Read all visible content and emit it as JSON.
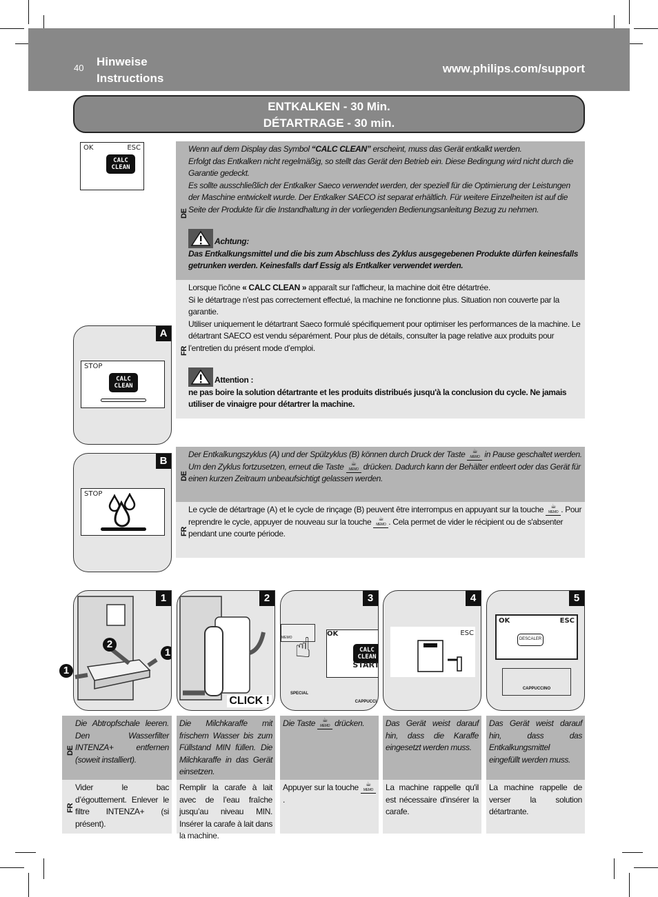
{
  "header": {
    "page_number": "40",
    "title_line1": "Hinweise",
    "title_line2": "Instructions",
    "url": "www.philips.com/support"
  },
  "section_title": {
    "line1": "ENTKALKEN - 30 Min.",
    "line2": "DÉTARTRAGE - 30 min."
  },
  "colors": {
    "header_bg": "#888888",
    "de_bg": "#b4b4b4",
    "fr_bg": "#e6e6e6",
    "badge_bg": "#111111"
  },
  "display_main": {
    "ok": "OK",
    "esc": "ESC",
    "icon_line1": "CALC",
    "icon_line2": "CLEAN"
  },
  "display_a": {
    "badge": "A",
    "stop": "STOP",
    "icon_line1": "CALC",
    "icon_line2": "CLEAN"
  },
  "display_b": {
    "badge": "B",
    "stop": "STOP",
    "icon": "water-drops-icon"
  },
  "intro": {
    "de": {
      "lang": "DE",
      "l1_pre": "Wenn auf dem Display das Symbol ",
      "l1_bold": "“CALC CLEAN”",
      "l1_post": " erscheint, muss das Gerät entkalkt werden.",
      "l2": "Erfolgt das Entkalken nicht regelmäßig, so stellt das Gerät den Betrieb ein. Diese Bedingung wird nicht durch die Garantie gedeckt.",
      "l3": "Es sollte ausschließlich der Entkalker Saeco verwendet werden, der speziell für die Optimierung der Leistungen der Maschine entwickelt wurde. Der Entkalker SAECO ist separat erhältlich. Für weitere Einzelheiten ist auf die Seite der Produkte für die Instandhaltung in der vorliegenden Bedienungsanleitung Bezug zu nehmen.",
      "warning_label": "Achtung:",
      "warning_text": "Das Entkalkungsmittel und die bis zum Abschluss des Zyklus ausgegebenen Produkte dürfen keinesfalls getrunken werden. Keinesfalls darf Essig als Entkalker verwendet werden."
    },
    "fr": {
      "lang": "FR",
      "l1_pre": "Lorsque l'icône ",
      "l1_bold": "« CALC CLEAN »",
      "l1_post": " apparaît sur l'afficheur, la machine doit être détartrée.",
      "l2": "Si le détartrage n'est pas correctement effectué, la machine ne fonctionne plus. Situation non couverte par la garantie.",
      "l3": "Utiliser uniquement le détartrant Saeco formulé spécifiquement pour optimiser les  performances de la machine. Le détartrant SAECO est vendu séparément. Pour plus de détails, consulter la page relative aux produits pour l’entretien du présent mode d’emploi.",
      "warning_label": "Attention :",
      "warning_text": "ne pas boire la solution détartrante et les produits distribués jusqu'à la conclusion du cycle. Ne jamais utiliser de vinaigre pour détartrer la machine."
    }
  },
  "pause": {
    "de": {
      "lang": "DE",
      "p1": "Der Entkalkungszyklus (A) und der Spülzyklus (B) können durch Druck der Taste ",
      "p2": " in Pause geschaltet werden. Um den Zyklus fortzusetzen, erneut die Taste ",
      "p3": " drücken. Dadurch kann der Behälter entleert oder das Gerät für einen kurzen Zeitraum unbeaufsichtigt gelassen werden."
    },
    "fr": {
      "lang": "FR",
      "p1": "Le cycle de détartrage (A) et le cycle de rinçage (B) peuvent être interrompus en appuyant sur la touche ",
      "p2": ". Pour reprendre le cycle, appuyer de nouveau sur la touche ",
      "p3": ". Cela permet de vider le récipient ou de s'absenter pendant une courte période."
    },
    "memo_label": "MEMO"
  },
  "steps": [
    {
      "badge": "1",
      "image": "drip-tray-removal",
      "callouts": [
        "1",
        "2",
        "1"
      ],
      "de": "Die Abtropfschale leeren. Den Wasserfilter INTENZA+ entfernen (soweit installiert).",
      "fr": "Vider le bac d’égouttement. Enlever le filtre INTENZA+ (si présent)."
    },
    {
      "badge": "2",
      "image": "milk-carafe-insert",
      "caption": "CLICK !",
      "de": "Die Milchkaraffe mit frischem Wasser bis zum Füllstand MIN füllen. Die Milchkaraffe in das Gerät einsetzen.",
      "fr": "Remplir la carafe à lait avec de l’eau fraîche jusqu’au niveau MIN. Insérer la carafe à lait dans la machine."
    },
    {
      "badge": "3",
      "image": "press-memo-button",
      "screen_ok": "OK",
      "screen_icon1": "CALC",
      "screen_icon2": "CLEAN",
      "screen_start": "START",
      "btn_memo": "MEMO",
      "btn_special": "SPECIAL",
      "btn_cappuccino": "CAPPUCCI",
      "de_pre": "Die Taste ",
      "de_post": " drücken.",
      "fr_pre": "Appuyer sur la touche ",
      "fr_post": "."
    },
    {
      "badge": "4",
      "image": "insert-carafe-display",
      "screen_esc": "ESC",
      "de": "Das Gerät weist darauf hin, dass die Karaffe eingesetzt werden muss.",
      "fr": "La machine rappelle qu'il est nécessaire d'insérer la carafe."
    },
    {
      "badge": "5",
      "image": "descaler-display",
      "screen_ok": "OK",
      "screen_esc": "ESC",
      "bottle_label": "DESCALER",
      "btn_cappuccino": "CAPPUCCINO",
      "de": "Das Gerät weist darauf hin, dass das Entkalkungsmittel eingefüllt werden muss.",
      "fr": "La machine rappelle de verser la solution détartrante."
    }
  ],
  "step_lang": {
    "de": "DE",
    "fr": "FR"
  }
}
